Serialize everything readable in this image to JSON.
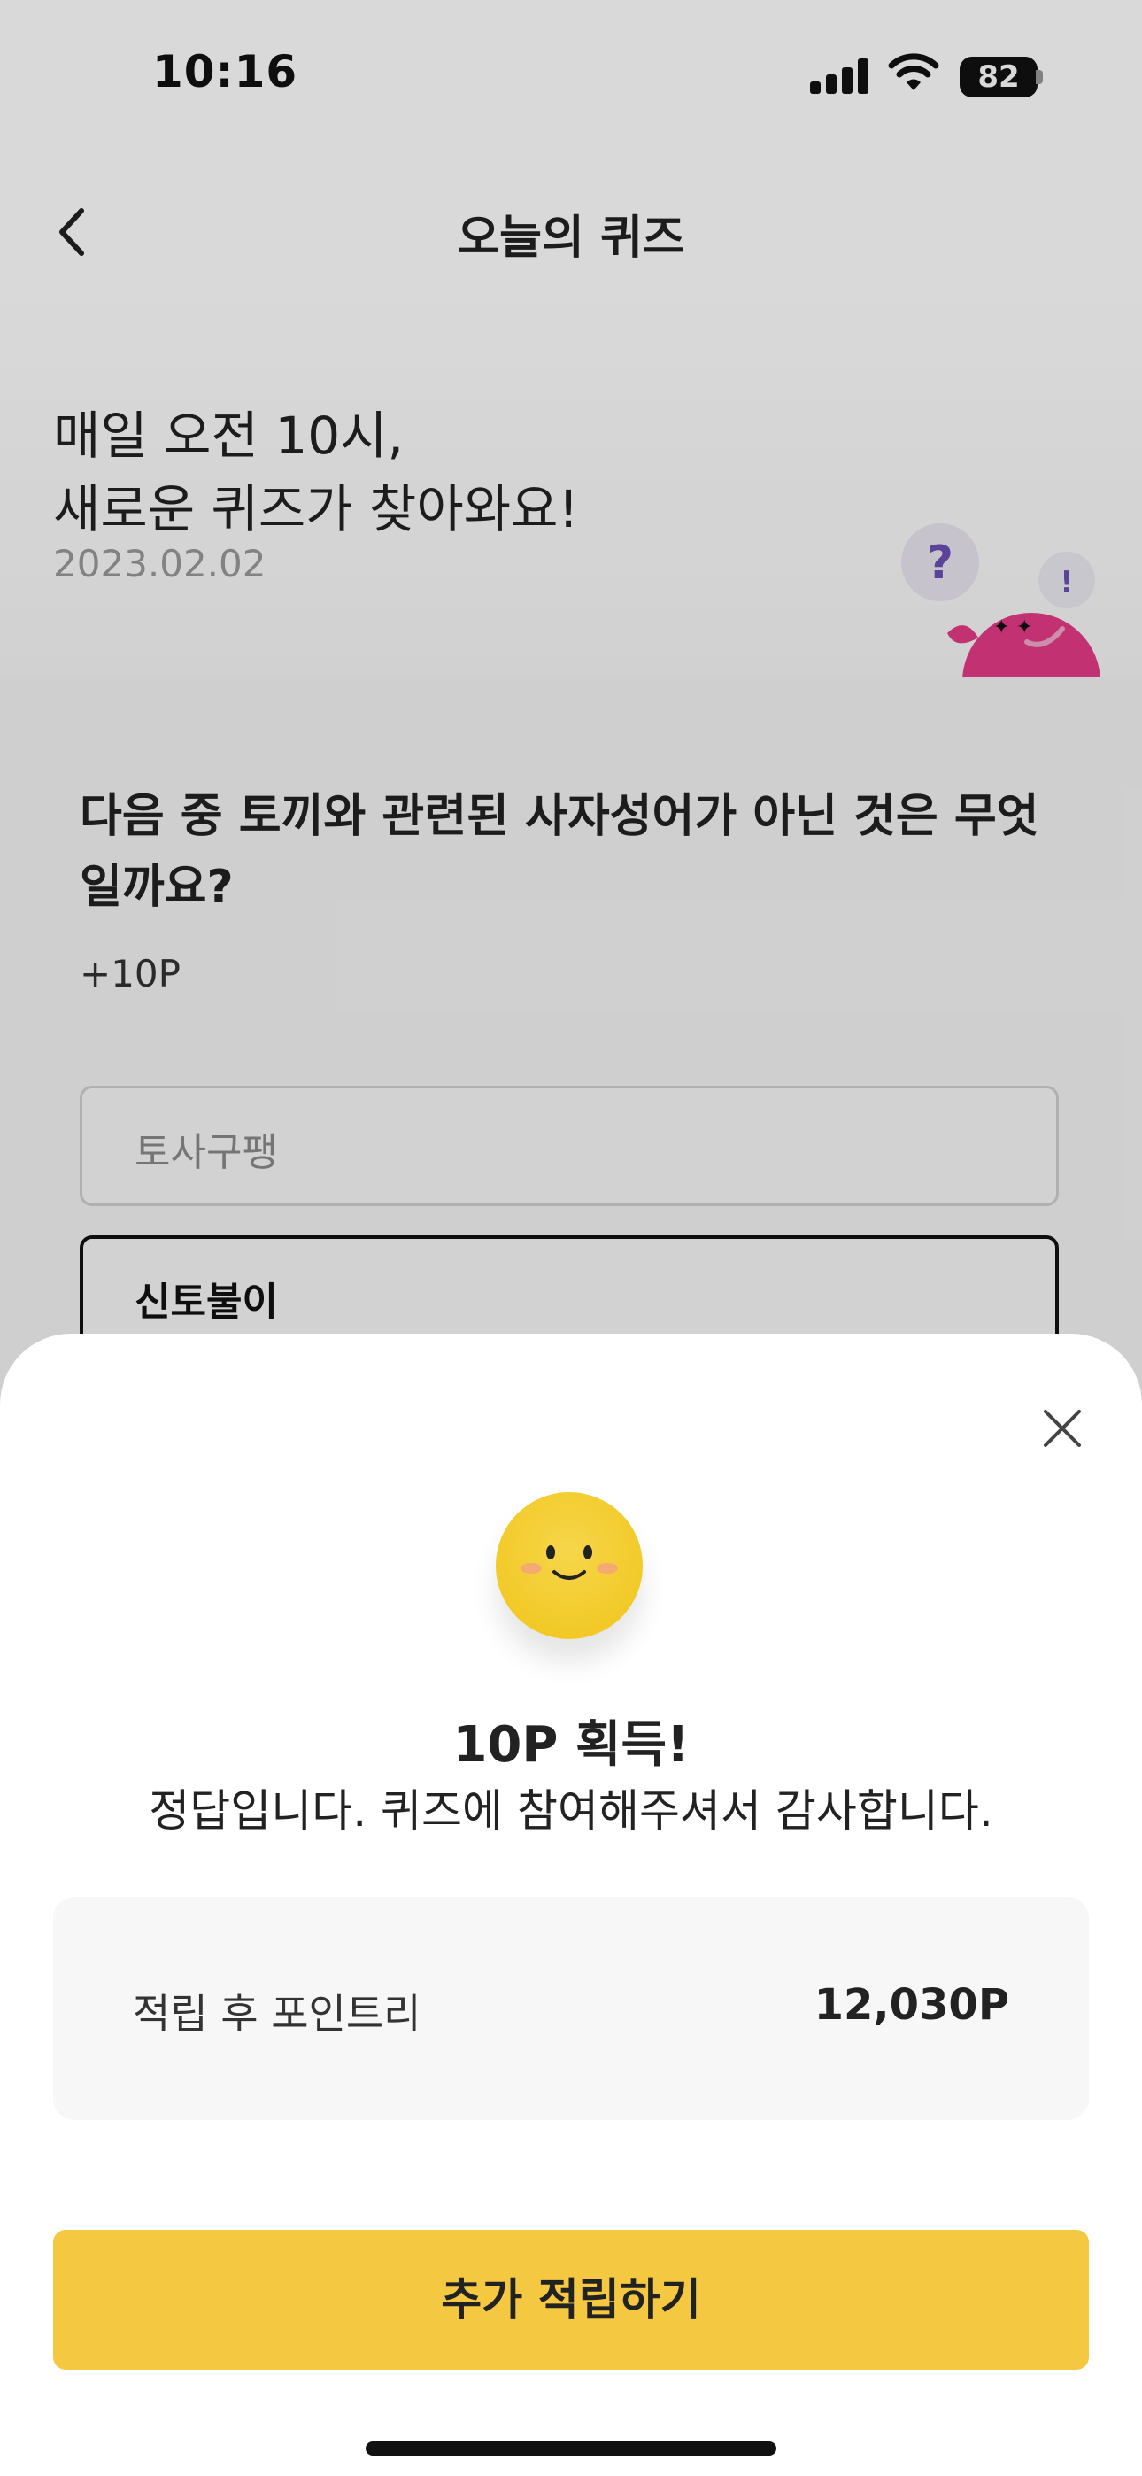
{
  "status_bar": {
    "time": "10:16",
    "battery": "82"
  },
  "nav": {
    "title": "오늘의 퀴즈"
  },
  "hero": {
    "line1": "매일 오전 10시,",
    "line2": "새로운 퀴즈가 찾아와요!",
    "date": "2023.02.02"
  },
  "quiz": {
    "question": "다음 중 토끼와 관련된 사자성어가 아닌 것은 무엇일까요?",
    "points": "+10P",
    "options": [
      {
        "label": "토사구팽"
      },
      {
        "label": "신토불이"
      }
    ]
  },
  "result_sheet": {
    "title": "10P 획득!",
    "message": "정답입니다. 퀴즈에 참여해주셔서 감사합니다.",
    "summary_label": "적립 후 포인트리",
    "summary_value": "12,030P",
    "cta_label": "추가 적립하기"
  },
  "icons": {
    "back": "chevron-left-icon",
    "close": "close-icon",
    "emoji": "smiley-face-icon",
    "mascot": "mascot-character"
  },
  "colors": {
    "accent": "#f5c842",
    "mascot_pink": "#e43a86",
    "question_bubble": "#6b4fb5"
  }
}
